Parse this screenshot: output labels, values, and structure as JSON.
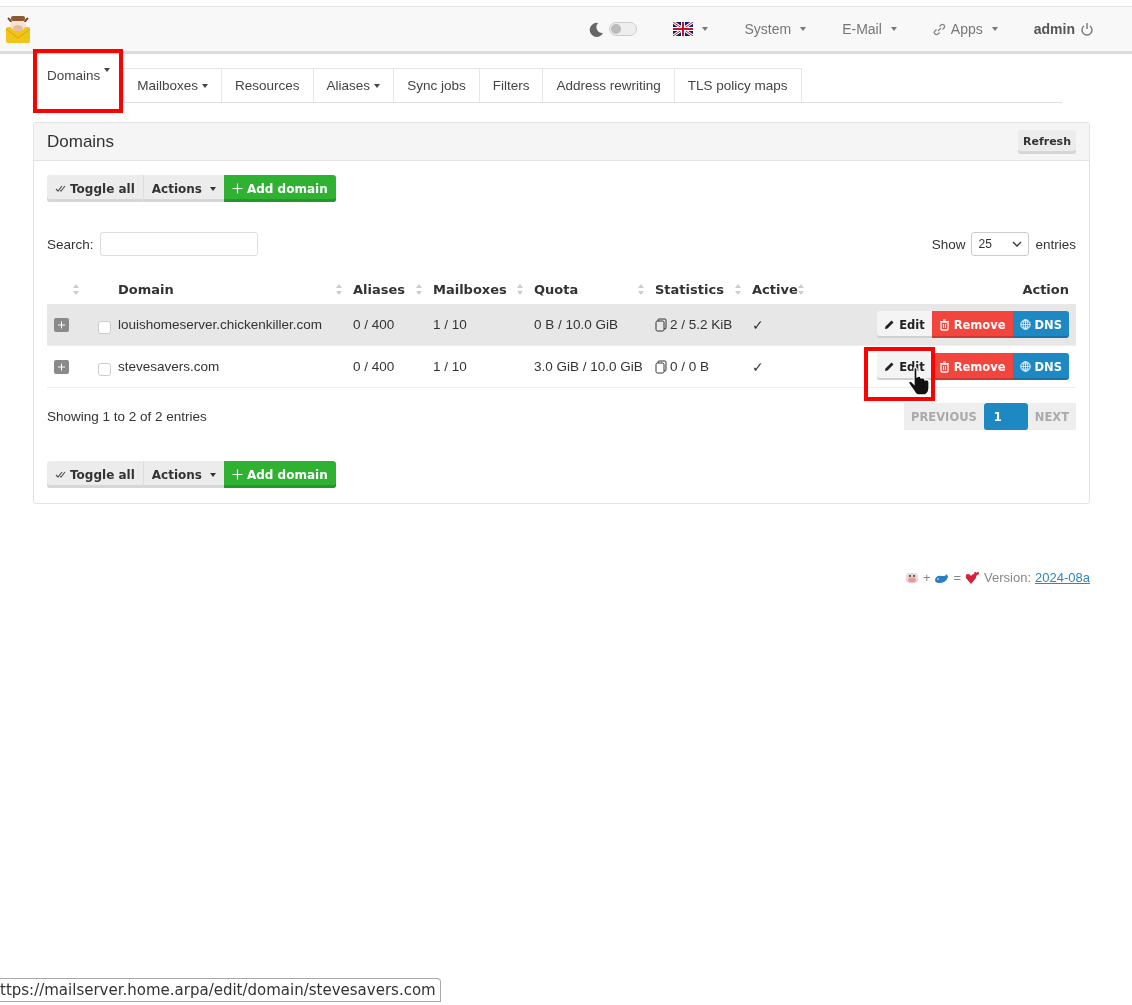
{
  "navbar": {
    "dark_mode_on": false,
    "menus": [
      {
        "kind": "flag",
        "dropdown": true
      },
      {
        "kind": "text",
        "label": "System",
        "dropdown": true
      },
      {
        "kind": "text",
        "label": "E-Mail",
        "dropdown": true
      },
      {
        "kind": "link",
        "label": "Apps",
        "dropdown": true
      }
    ],
    "user": "admin"
  },
  "tabs": [
    {
      "label": "Domains",
      "dropdown": true,
      "selected": true,
      "highlighted": true
    },
    {
      "label": "Mailboxes",
      "dropdown": true,
      "selected": false,
      "highlighted": false
    },
    {
      "label": "Resources",
      "dropdown": false,
      "selected": false,
      "highlighted": false
    },
    {
      "label": "Aliases",
      "dropdown": true,
      "selected": false,
      "highlighted": false
    },
    {
      "label": "Sync jobs",
      "dropdown": false,
      "selected": false,
      "highlighted": false
    },
    {
      "label": "Filters",
      "dropdown": false,
      "selected": false,
      "highlighted": false
    },
    {
      "label": "Address rewriting",
      "dropdown": false,
      "selected": false,
      "highlighted": false
    },
    {
      "label": "TLS policy maps",
      "dropdown": false,
      "selected": false,
      "highlighted": false
    }
  ],
  "panel": {
    "title": "Domains",
    "refresh": "Refresh",
    "toolbar": {
      "toggle_all": "Toggle all",
      "actions": "Actions",
      "add": "Add domain"
    },
    "search": {
      "label": "Search:"
    },
    "show": {
      "label": "Show",
      "value": "25",
      "suffix": "entries"
    },
    "expand_column_sortable": true,
    "columns": [
      {
        "label": "Domain",
        "sortable": true
      },
      {
        "label": "Aliases",
        "sortable": true
      },
      {
        "label": "Mailboxes",
        "sortable": true
      },
      {
        "label": "Quota",
        "sortable": true
      },
      {
        "label": "Statistics",
        "sortable": true
      },
      {
        "label": "Active",
        "sortable": true
      },
      {
        "label": "Action",
        "sortable": false
      }
    ],
    "rows": [
      {
        "domain": "louishomeserver.chickenkiller.com",
        "aliases": "0 / 400",
        "mailboxes": "1 / 10",
        "quota": "0 B / 10.0 GiB",
        "statistics": "2 / 5.2 KiB",
        "active": "✓",
        "checked": false,
        "hovered": true,
        "edit_highlighted": false,
        "pointer_on_edit": false,
        "actions": [
          "Edit",
          "Remove",
          "DNS"
        ]
      },
      {
        "domain": "stevesavers.com",
        "aliases": "0 / 400",
        "mailboxes": "1 / 10",
        "quota": "3.0 GiB / 10.0 GiB",
        "statistics": "0 / 0 B",
        "active": "✓",
        "checked": false,
        "hovered": false,
        "edit_highlighted": true,
        "pointer_on_edit": true,
        "actions": [
          "Edit",
          "Remove",
          "DNS"
        ]
      }
    ],
    "info": "Showing 1 to 2 of 2 entries",
    "pagination": [
      {
        "label": "PREVIOUS",
        "kind": "nav",
        "disabled": true,
        "selected": false
      },
      {
        "label": "1",
        "kind": "page",
        "disabled": false,
        "selected": true
      },
      {
        "label": "NEXT",
        "kind": "nav",
        "disabled": true,
        "selected": false
      }
    ],
    "bottom_toolbar": {
      "toggle_all": "Toggle all",
      "actions": "Actions",
      "add": "Add domain"
    }
  },
  "footer": {
    "plus": "+",
    "equals": "=",
    "version_label": "Version:",
    "version": "2024-08a"
  },
  "status_bar": {
    "url": "ttps://mailserver.home.arpa/edit/domain/stevesavers.com"
  }
}
